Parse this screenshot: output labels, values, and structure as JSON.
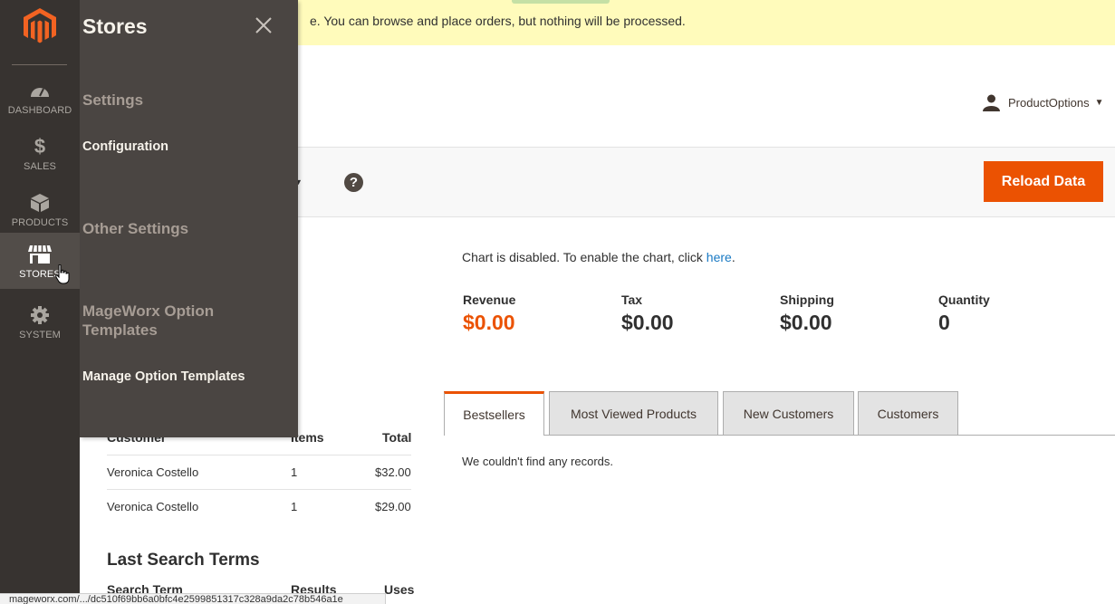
{
  "notice": {
    "text": "e. You can browse and place orders, but nothing will be processed."
  },
  "nav": {
    "items": [
      {
        "label": "DASHBOARD",
        "icon": "dashboard-icon"
      },
      {
        "label": "SALES",
        "icon": "dollar-icon"
      },
      {
        "label": "PRODUCTS",
        "icon": "box-icon"
      },
      {
        "label": "STORES",
        "icon": "store-icon",
        "active": true
      },
      {
        "label": "SYSTEM",
        "icon": "gear-icon"
      }
    ]
  },
  "flyout": {
    "title": "Stores",
    "sections": [
      {
        "heading": "Settings",
        "links": [
          "Configuration"
        ]
      },
      {
        "heading": "Other Settings",
        "links": []
      },
      {
        "heading": "MageWorx Option Templates",
        "links": [
          "Manage Option Templates"
        ]
      }
    ]
  },
  "header": {
    "user": "ProductOptions"
  },
  "actions": {
    "reload_label": "Reload Data",
    "help": "?"
  },
  "chart": {
    "message": "Chart is disabled. To enable the chart, click ",
    "link": "here",
    "suffix": "."
  },
  "totals": [
    {
      "label": "Revenue",
      "value": "$0.00"
    },
    {
      "label": "Tax",
      "value": "$0.00"
    },
    {
      "label": "Shipping",
      "value": "$0.00"
    },
    {
      "label": "Quantity",
      "value": "0"
    }
  ],
  "tabs": [
    "Bestsellers",
    "Most Viewed Products",
    "New Customers",
    "Customers"
  ],
  "tab_content": "We couldn't find any records.",
  "last_orders": {
    "columns": [
      "Customer",
      "Items",
      "Total"
    ],
    "rows": [
      {
        "customer": "Veronica Costello",
        "items": "1",
        "total": "$32.00"
      },
      {
        "customer": "Veronica Costello",
        "items": "1",
        "total": "$29.00"
      }
    ]
  },
  "last_search": {
    "title": "Last Search Terms",
    "columns": [
      "Search Term",
      "Results",
      "Uses"
    ]
  },
  "statusbar": {
    "url": "mageworx.com/.../dc510f69bb6a0bfc4e2599851317c328a9da2c78b546a1e"
  },
  "colors": {
    "accent": "#eb5202",
    "nav_bg": "#373330",
    "flyout_bg": "#4a4542",
    "notice_bg": "#fffbbb",
    "link": "#1979c3"
  }
}
